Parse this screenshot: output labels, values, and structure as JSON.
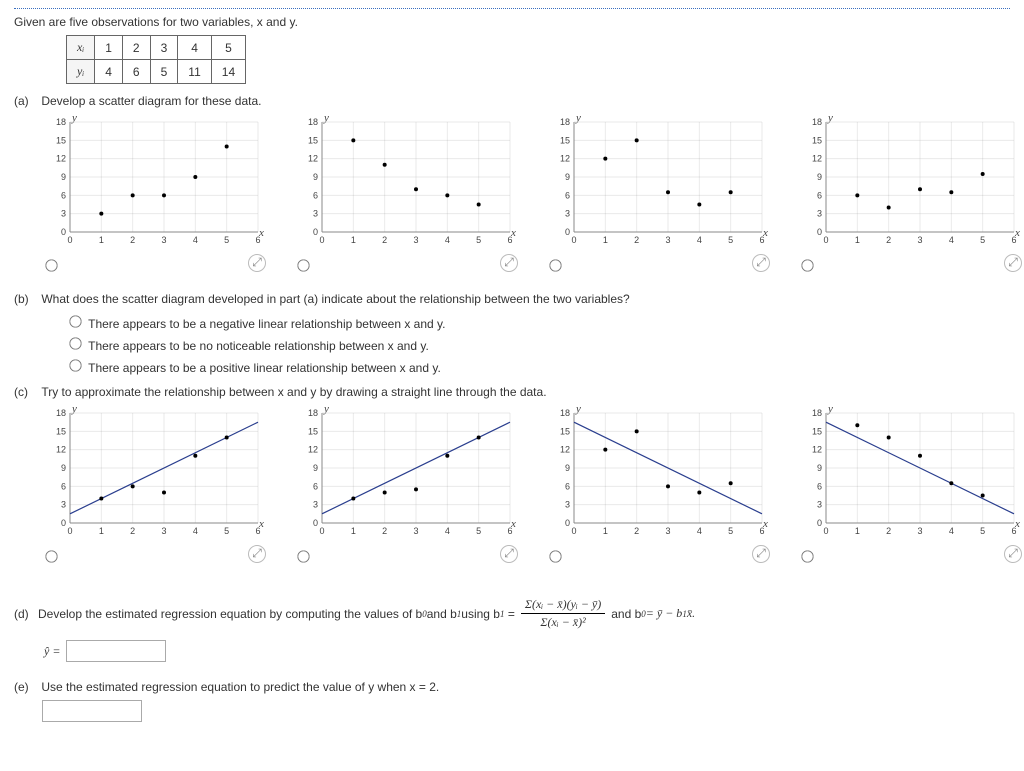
{
  "intro": "Given are five observations for two variables, x and y.",
  "table": {
    "row_x_label": "xᵢ",
    "row_y_label": "yᵢ",
    "x": [
      "1",
      "2",
      "3",
      "4",
      "5"
    ],
    "y": [
      "4",
      "6",
      "5",
      "11",
      "14"
    ]
  },
  "parts": {
    "a": {
      "label": "(a)",
      "text": "Develop a scatter diagram for these data."
    },
    "b": {
      "label": "(b)",
      "text": "What does the scatter diagram developed in part (a) indicate about the relationship between the two variables?",
      "opt1": "There appears to be a negative linear relationship between x and y.",
      "opt2": "There appears to be no noticeable relationship between x and y.",
      "opt3": "There appears to be a positive linear relationship between x and y."
    },
    "c": {
      "label": "(c)",
      "text": "Try to approximate the relationship between x and y by drawing a straight line through the data."
    },
    "d": {
      "label": "(d)",
      "pre": "Develop the estimated regression equation by computing the values of b",
      "mid1": " and b",
      "mid2": " using b",
      "eq": "=",
      "frac_top": "Σ(xᵢ − x̄)(yᵢ − ȳ)",
      "frac_bot": "Σ(xᵢ − x̄)²",
      "and": " and b",
      "b0eq": " = ȳ − b",
      "b0tail": "x̄.",
      "yhat": "ŷ ="
    },
    "e": {
      "label": "(e)",
      "text": "Use the estimated regression equation to predict the value of y when x = 2."
    }
  },
  "axis": {
    "y": "y",
    "x": "x",
    "yticks": [
      "0",
      "3",
      "6",
      "9",
      "12",
      "15",
      "18"
    ],
    "xticks": [
      "0",
      "1",
      "2",
      "3",
      "4",
      "5",
      "6"
    ]
  },
  "chart_data": [
    {
      "id": "a",
      "type": "scatter",
      "xlim": [
        0,
        6
      ],
      "ylim": [
        0,
        18
      ],
      "xticks": [
        0,
        1,
        2,
        3,
        4,
        5,
        6
      ],
      "yticks": [
        0,
        3,
        6,
        9,
        12,
        15,
        18
      ],
      "xlabel": "x",
      "ylabel": "y",
      "panels": [
        {
          "points": [
            [
              1,
              3
            ],
            [
              2,
              6
            ],
            [
              3,
              6
            ],
            [
              4,
              9
            ],
            [
              5,
              14
            ]
          ]
        },
        {
          "points": [
            [
              1,
              15
            ],
            [
              2,
              11
            ],
            [
              3,
              7
            ],
            [
              4,
              6
            ],
            [
              5,
              4.5
            ]
          ]
        },
        {
          "points": [
            [
              1,
              12
            ],
            [
              2,
              15
            ],
            [
              3,
              6.5
            ],
            [
              4,
              4.5
            ],
            [
              5,
              6.5
            ]
          ]
        },
        {
          "points": [
            [
              1,
              6
            ],
            [
              2,
              4
            ],
            [
              3,
              7
            ],
            [
              4,
              6.5
            ],
            [
              5,
              9.5
            ]
          ]
        }
      ]
    },
    {
      "id": "c",
      "type": "scatter",
      "xlim": [
        0,
        6
      ],
      "ylim": [
        0,
        18
      ],
      "xticks": [
        0,
        1,
        2,
        3,
        4,
        5,
        6
      ],
      "yticks": [
        0,
        3,
        6,
        9,
        12,
        15,
        18
      ],
      "xlabel": "x",
      "ylabel": "y",
      "panels": [
        {
          "points": [
            [
              1,
              4
            ],
            [
              2,
              6
            ],
            [
              3,
              5
            ],
            [
              4,
              11
            ],
            [
              5,
              14
            ]
          ],
          "line": [
            [
              0,
              1.5
            ],
            [
              6,
              16.5
            ]
          ]
        },
        {
          "points": [
            [
              1,
              4
            ],
            [
              2,
              5
            ],
            [
              3,
              5.5
            ],
            [
              4,
              11
            ],
            [
              5,
              14
            ]
          ],
          "line": [
            [
              0,
              1.5
            ],
            [
              6,
              16.5
            ]
          ]
        },
        {
          "points": [
            [
              1,
              12
            ],
            [
              2,
              15
            ],
            [
              3,
              6
            ],
            [
              4,
              5
            ],
            [
              5,
              6.5
            ]
          ],
          "line": [
            [
              0,
              16.5
            ],
            [
              6,
              1.5
            ]
          ]
        },
        {
          "points": [
            [
              1,
              16
            ],
            [
              2,
              14
            ],
            [
              3,
              11
            ],
            [
              4,
              6.5
            ],
            [
              5,
              4.5
            ]
          ],
          "line": [
            [
              0,
              16.5
            ],
            [
              6,
              1.5
            ]
          ]
        }
      ]
    }
  ]
}
